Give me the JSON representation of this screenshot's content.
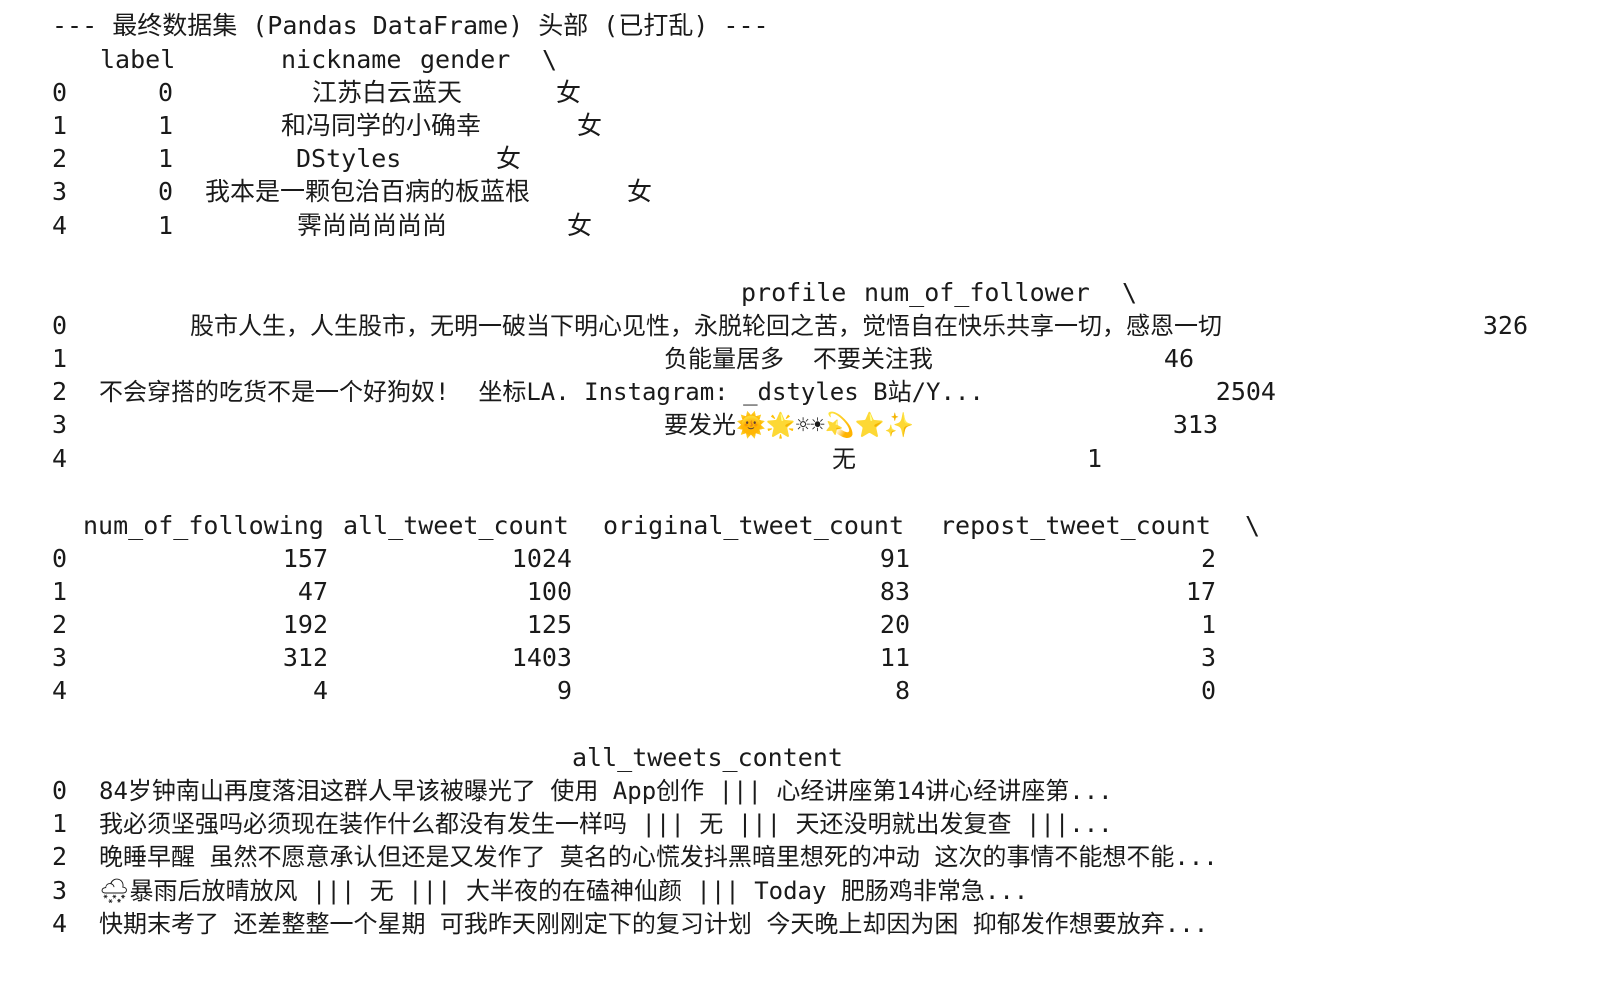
{
  "title": "--- 最终数据集 (Pandas DataFrame) 头部 (已打乱) ---",
  "section1": {
    "headers": [
      "label",
      "nickname",
      "gender",
      "\\"
    ],
    "rows": [
      {
        "idx": "0",
        "label": "0",
        "nickname": "江苏白云蓝天",
        "gender": "女"
      },
      {
        "idx": "1",
        "label": "1",
        "nickname": "和冯同学的小确幸",
        "gender": "女"
      },
      {
        "idx": "2",
        "label": "1",
        "nickname": "DStyles",
        "gender": "女"
      },
      {
        "idx": "3",
        "label": "0",
        "nickname": "我本是一颗包治百病的板蓝根",
        "gender": "女"
      },
      {
        "idx": "4",
        "label": "1",
        "nickname": "霁尚尚尚尚尚",
        "gender": "女"
      }
    ]
  },
  "section2": {
    "headers": [
      "profile",
      "num_of_follower",
      "\\"
    ],
    "rows": [
      {
        "idx": "0",
        "profile": "股市人生，人生股市，无明一破当下明心见性，永脱轮回之苦，觉悟自在快乐共享一切，感恩一切",
        "follower": "326"
      },
      {
        "idx": "1",
        "profile": "负能量居多  不要关注我",
        "follower": "46"
      },
      {
        "idx": "2",
        "profile": "不会穿搭的吃货不是一个好狗奴!  坐标LA. Instagram: _dstyles B站/Y...",
        "follower": "2504"
      },
      {
        "idx": "3",
        "profile": "要发光🌞🌟☼☀💫⭐✨",
        "follower": "313"
      },
      {
        "idx": "4",
        "profile": "无",
        "follower": "1"
      }
    ]
  },
  "section3": {
    "headers": [
      "num_of_following",
      "all_tweet_count",
      "original_tweet_count",
      "repost_tweet_count",
      "\\"
    ],
    "rows": [
      {
        "idx": "0",
        "following": "157",
        "all": "1024",
        "original": "91",
        "repost": "2"
      },
      {
        "idx": "1",
        "following": "47",
        "all": "100",
        "original": "83",
        "repost": "17"
      },
      {
        "idx": "2",
        "following": "192",
        "all": "125",
        "original": "20",
        "repost": "1"
      },
      {
        "idx": "3",
        "following": "312",
        "all": "1403",
        "original": "11",
        "repost": "3"
      },
      {
        "idx": "4",
        "following": "4",
        "all": "9",
        "original": "8",
        "repost": "0"
      }
    ]
  },
  "section4": {
    "header": "all_tweets_content",
    "rows": [
      {
        "idx": "0",
        "content": "84岁钟南山再度落泪这群人早该被曝光了 使用 App创作 ||| 心经讲座第14讲心经讲座第..."
      },
      {
        "idx": "1",
        "content": "我必须坚强吗必须现在装作什么都没有发生一样吗 ||| 无 ||| 天还没明就出发复查 |||..."
      },
      {
        "idx": "2",
        "content": "晚睡早醒 虽然不愿意承认但还是又发作了 莫名的心慌发抖黑暗里想死的冲动 这次的事情不能想不能..."
      },
      {
        "idx": "3",
        "content": "🌨暴雨后放晴放风 ||| 无 ||| 大半夜的在磕神仙颜 ||| Today 肥肠鸡非常急..."
      },
      {
        "idx": "4",
        "content": "快期末考了 还差整整一个星期 可我昨天刚刚定下的复习计划 今天晚上却因为困 抑郁发作想要放弃..."
      }
    ]
  }
}
